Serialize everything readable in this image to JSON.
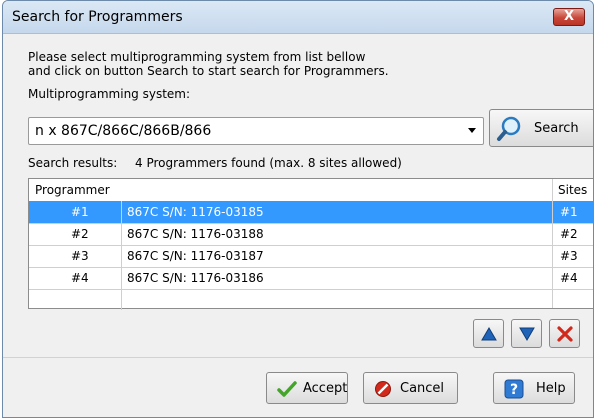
{
  "window": {
    "title": "Search for Programmers",
    "close_glyph": "X"
  },
  "instructions": {
    "line1": "Please select multiprogramming system from list bellow",
    "line2": "and click on button Search to start search for Programmers."
  },
  "system": {
    "label": "Multiprogramming system:",
    "selected": "n x 867C/866C/866B/866"
  },
  "search_button": {
    "label": "Search",
    "icon": "magnifier-icon"
  },
  "results": {
    "label": "Search results:",
    "summary": "4 Programmers found (max. 8 sites allowed)",
    "columns": {
      "programmer": "Programmer",
      "sites": "Sites"
    },
    "rows": [
      {
        "index": "#1",
        "name": "867C S/N: 1176-03185",
        "site": "#1",
        "selected": true
      },
      {
        "index": "#2",
        "name": "867C S/N: 1176-03188",
        "site": "#2",
        "selected": false
      },
      {
        "index": "#3",
        "name": "867C S/N: 1176-03187",
        "site": "#3",
        "selected": false
      },
      {
        "index": "#4",
        "name": "867C S/N: 1176-03186",
        "site": "#4",
        "selected": false
      }
    ]
  },
  "list_controls": {
    "up_icon": "arrow-up-icon",
    "down_icon": "arrow-down-icon",
    "delete_icon": "delete-icon"
  },
  "footer": {
    "accept": "Accept",
    "cancel": "Cancel",
    "help": "Help"
  },
  "colors": {
    "selection": "#3399ff",
    "title_bg": "#c5d8ec",
    "close_bg": "#c9473a",
    "accept_green": "#44a52a",
    "cancel_red": "#d1291c",
    "help_blue": "#2f7ad3"
  }
}
